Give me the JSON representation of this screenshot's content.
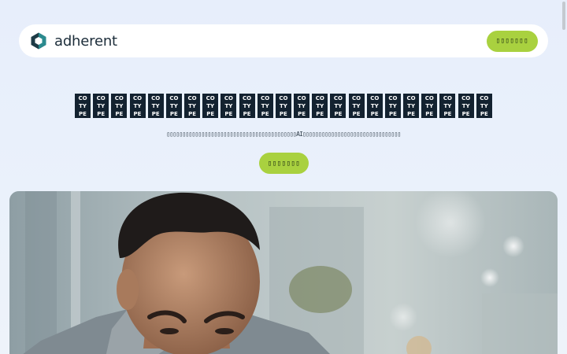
{
  "brand": {
    "name": "adherent"
  },
  "header": {
    "cta_label": "▯▯▯▯▯▯▯"
  },
  "hero": {
    "headline_glyph": "CO\nTY\nPE",
    "headline_glyph_count": 23,
    "subline": "▯▯▯▯▯▯▯▯▯▯▯▯▯▯▯▯▯▯▯▯▯▯▯▯▯▯▯▯▯▯▯▯▯▯▯▯▯▯▯▯▯AI▯▯▯▯▯▯▯▯▯▯▯▯▯▯▯▯▯▯▯▯▯▯▯▯▯▯▯▯▯▯▯",
    "cta_label": "▯▯▯▯▯▯▯",
    "photo_icon": "person-photo"
  },
  "colors": {
    "accent": "#a9d13f",
    "background": "#e7eefb",
    "text_dark": "#132230",
    "logo_teal": "#2a8a8e"
  }
}
